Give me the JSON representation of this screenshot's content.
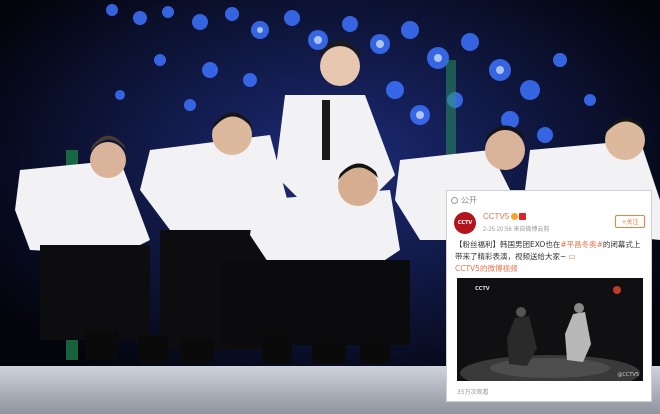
{
  "weibo_card": {
    "visibility": "公开",
    "account_name": "CCTV5",
    "avatar_text": "CCTV",
    "timestamp": "2-25 20:56",
    "source": "来自微博云剪",
    "follow_label": "+关注",
    "post_prefix": "【粉丝福利】韩国男团EXO也在",
    "hashtag": "#平昌冬奥#",
    "post_middle": "的闭幕式上带来了精彩表演，视频送给大家~",
    "video_link": "CCTV5的微博视频",
    "video_logo": "CCTV",
    "video_watermark": "@CCTV5",
    "views": "35万次观看"
  },
  "colors": {
    "accent": "#eb7350",
    "stage_blue": "#2b5cff",
    "jacket": "#f2f2f4"
  },
  "icons": [
    "globe-icon",
    "play-link-icon",
    "verified-badge-icon"
  ]
}
